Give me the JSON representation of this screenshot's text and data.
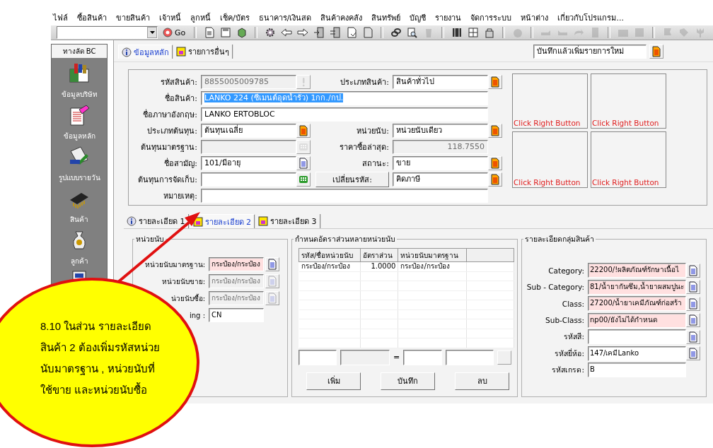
{
  "menu": [
    "ไฟล์",
    "ซื้อสินค้า",
    "ขายสินค้า",
    "เจ้าหนี้",
    "ลูกหนี้",
    "เช็ค/บัตร",
    "ธนาคาร/เงินสด",
    "สินค้าคงคลัง",
    "สินทรัพย์",
    "บัญชี",
    "รายงาน",
    "จัดการระบบ",
    "หน้าต่าง",
    "เกี่ยวกับโปรแกรม..."
  ],
  "toolbar": {
    "go_label": "Go",
    "groups": [
      [
        {
          "disabled": false
        },
        {
          "disabled": false
        },
        {
          "disabled": false
        }
      ],
      [
        {
          "disabled": false
        },
        {
          "disabled": false
        },
        {
          "disabled": false
        },
        {
          "disabled": false
        },
        {
          "disabled": false
        },
        {
          "disabled": false
        },
        {
          "disabled": false
        }
      ],
      [
        {
          "disabled": false
        },
        {
          "disabled": false
        },
        {
          "disabled": true
        }
      ],
      [
        {
          "disabled": false
        },
        {
          "disabled": false
        },
        {
          "disabled": false
        }
      ],
      [
        {
          "disabled": true
        }
      ],
      [
        {
          "disabled": true
        },
        {
          "disabled": true
        },
        {
          "disabled": true
        },
        {
          "disabled": true
        }
      ],
      [
        {
          "disabled": true
        },
        {
          "disabled": true
        }
      ],
      [
        {
          "disabled": true
        },
        {
          "disabled": true
        },
        {
          "disabled": true
        }
      ]
    ]
  },
  "sidebar": {
    "title": "ทางลัด BC",
    "items": [
      {
        "label": "ข้อมูลบริษัท"
      },
      {
        "label": "ข้อมูลหลัก"
      },
      {
        "label": "รูปแบบรายวัน"
      },
      {
        "label": "สินค้า"
      },
      {
        "label": "ลูกค้า"
      }
    ]
  },
  "main_tabs": [
    {
      "label": "ข้อมูลหลัก",
      "selected": true
    },
    {
      "label": "รายการอื่นๆ",
      "selected": false
    }
  ],
  "save_mode": {
    "value": "บันทึกแล้วเพิ่มรายการใหม่"
  },
  "form": {
    "rows": [
      {
        "cells": [
          {
            "label": "รหัสสินค้า:",
            "value": "8855005009785",
            "kind": "text",
            "disabled": true,
            "button": {
              "kind": "alert",
              "disabled": true
            }
          },
          {
            "label": "ประเภทสินค้า:",
            "value": "สินค้าทั่วไป",
            "kind": "text",
            "disabled": false,
            "button": {
              "kind": "list",
              "disabled": false
            }
          }
        ]
      },
      {
        "cells": [
          {
            "label": "ชื่อสินค้า:",
            "value": "LANKO 224 (ซีเมนต์อุดน้ำรั่ว) 1กก./กป.",
            "kind": "text",
            "disabled": false,
            "text_selected": true
          }
        ]
      },
      {
        "cells": [
          {
            "label": "ชื่อภาษาอังกฤษ:",
            "value": "LANKO ERTOBLOC",
            "kind": "text",
            "disabled": false,
            "text_selected": false
          }
        ]
      },
      {
        "cells": [
          {
            "label": "ประเภทต้นทุน:",
            "value": "ต้นทุนเฉลี่ย",
            "kind": "text",
            "disabled": false,
            "button": {
              "kind": "list",
              "disabled": false
            }
          },
          {
            "label": "หน่วยนับ:",
            "value": "หน่วยนับเดียว",
            "kind": "text",
            "disabled": false,
            "button": {
              "kind": "list",
              "disabled": false
            }
          }
        ]
      },
      {
        "cells": [
          {
            "label": "ต้นทุนมาตรฐาน:",
            "kind": "text",
            "disabled": true,
            "button": {
              "kind": "calc",
              "disabled": true
            }
          },
          {
            "label": "ราคาซื้อล่าสุด:",
            "value": "118.7550",
            "kind": "number",
            "disabled": true
          }
        ]
      },
      {
        "cells": [
          {
            "label": "ชื่อสามัญ:",
            "value": "101/มีอายุ",
            "kind": "text",
            "disabled": false,
            "button": {
              "kind": "doc",
              "disabled": false
            }
          },
          {
            "label": "สถานะ:",
            "value": "ขาย",
            "kind": "text",
            "disabled": false,
            "button": {
              "kind": "list",
              "disabled": false
            }
          }
        ]
      },
      {
        "cells": [
          {
            "label": "ต้นทุนการจัดเก็บ:",
            "kind": "text",
            "disabled": false,
            "button": {
              "kind": "grid",
              "disabled": false
            }
          },
          {
            "label": "เปลี่ยนรหัส:",
            "value": "คิดภาษี",
            "kind": "action",
            "disabled": false,
            "button": {
              "kind": "list",
              "disabled": false
            }
          }
        ]
      },
      {
        "cells": [
          {
            "label": "หมายเหตุ:",
            "kind": "text",
            "disabled": false
          }
        ]
      }
    ],
    "image_slots": [
      {
        "caption": "Click Right Button"
      },
      {
        "caption": "Click Right Button"
      },
      {
        "caption": "Click Right Button"
      },
      {
        "caption": "Click Right Button"
      }
    ]
  },
  "detail_tabs": [
    {
      "label": "รายละเอียด 1",
      "selected": false
    },
    {
      "label": "รายละเอียด 2",
      "selected": true
    },
    {
      "label": "รายละเอียด 3",
      "selected": false
    }
  ],
  "units": {
    "title": "หน่วยนับ",
    "fields": [
      {
        "label": "หน่วยนับมาตรฐาน:",
        "value": "กระป๋อง/กระป๋อง",
        "required": true,
        "disabled": false,
        "button": {
          "kind": "doc",
          "disabled": false
        }
      },
      {
        "label": "หน่วยนับขาย:",
        "value": "กระป๋อง/กระป๋อง",
        "required": false,
        "disabled": true,
        "button": {
          "kind": "doc",
          "disabled": true
        }
      },
      {
        "label": "น่วยนับซื้อ:",
        "value": "กระป๋อง/กระป๋อง",
        "required": false,
        "disabled": true,
        "button": {
          "kind": "doc",
          "disabled": true
        }
      },
      {
        "label": "ing :",
        "value": "CN",
        "required": false,
        "disabled": false
      }
    ]
  },
  "ratios": {
    "title": "กำหนดอัตราส่วนหลายหน่วยนับ",
    "columns": [
      "รหัส/ชื่อหน่วยนับ",
      "อัตราส่วน",
      "หน่วยนับมาตรฐาน"
    ],
    "rows": [
      [
        "กระป๋อง/กระป๋อง",
        "1.0000",
        "กระป๋อง/กระป๋อง"
      ]
    ],
    "inputs": [
      {
        "disabled": false
      },
      {
        "disabled": true
      },
      {
        "disabled": false
      },
      {
        "disabled": false
      }
    ],
    "equals_sign": "=",
    "buttons": [
      "เพิ่ม",
      "บันทึก",
      "ลบ"
    ]
  },
  "group": {
    "title": "รายละเอียดกลุ่มสินค้า",
    "fields": [
      {
        "label": "Category:",
        "value": "22200/!ผลิตภัณฑ์รักษาเนื้อไ",
        "required": true,
        "button": {
          "kind": "doc",
          "disabled": false
        }
      },
      {
        "label": "Sub - Category:",
        "value": "81/น้ำยากันซึม,น้ำยาผสมปูนะ",
        "required": true,
        "button": {
          "kind": "doc",
          "disabled": false
        }
      },
      {
        "label": "Class:",
        "value": "27200/น้ำยาเคมีภัณฑ์ก่อสร้า",
        "required": true,
        "button": {
          "kind": "doc",
          "disabled": false
        }
      },
      {
        "label": "Sub-Class:",
        "value": "np00/ยังไม่ได้กำหนด",
        "required": true,
        "button": {
          "kind": "doc",
          "disabled": false
        }
      },
      {
        "label": "รหัสสี:",
        "required": false,
        "button": {
          "kind": "doc",
          "disabled": false
        }
      },
      {
        "label": "รหัสยี่ห้อ:",
        "value": "147/เคมีLanko",
        "required": false,
        "button": {
          "kind": "doc",
          "disabled": false
        }
      },
      {
        "label": "รหัสเกรด:",
        "value": "B",
        "required": false
      }
    ]
  },
  "callout": {
    "lines": [
      "8.10 ในส่วน รายละเอียด",
      "สินค้า 2 ต้องเพิ่มรหัสหน่วย",
      "นับมาตรฐาน , หน่วยนับที่",
      "ใช้ขาย และหน่วยนับซื้อ"
    ]
  }
}
